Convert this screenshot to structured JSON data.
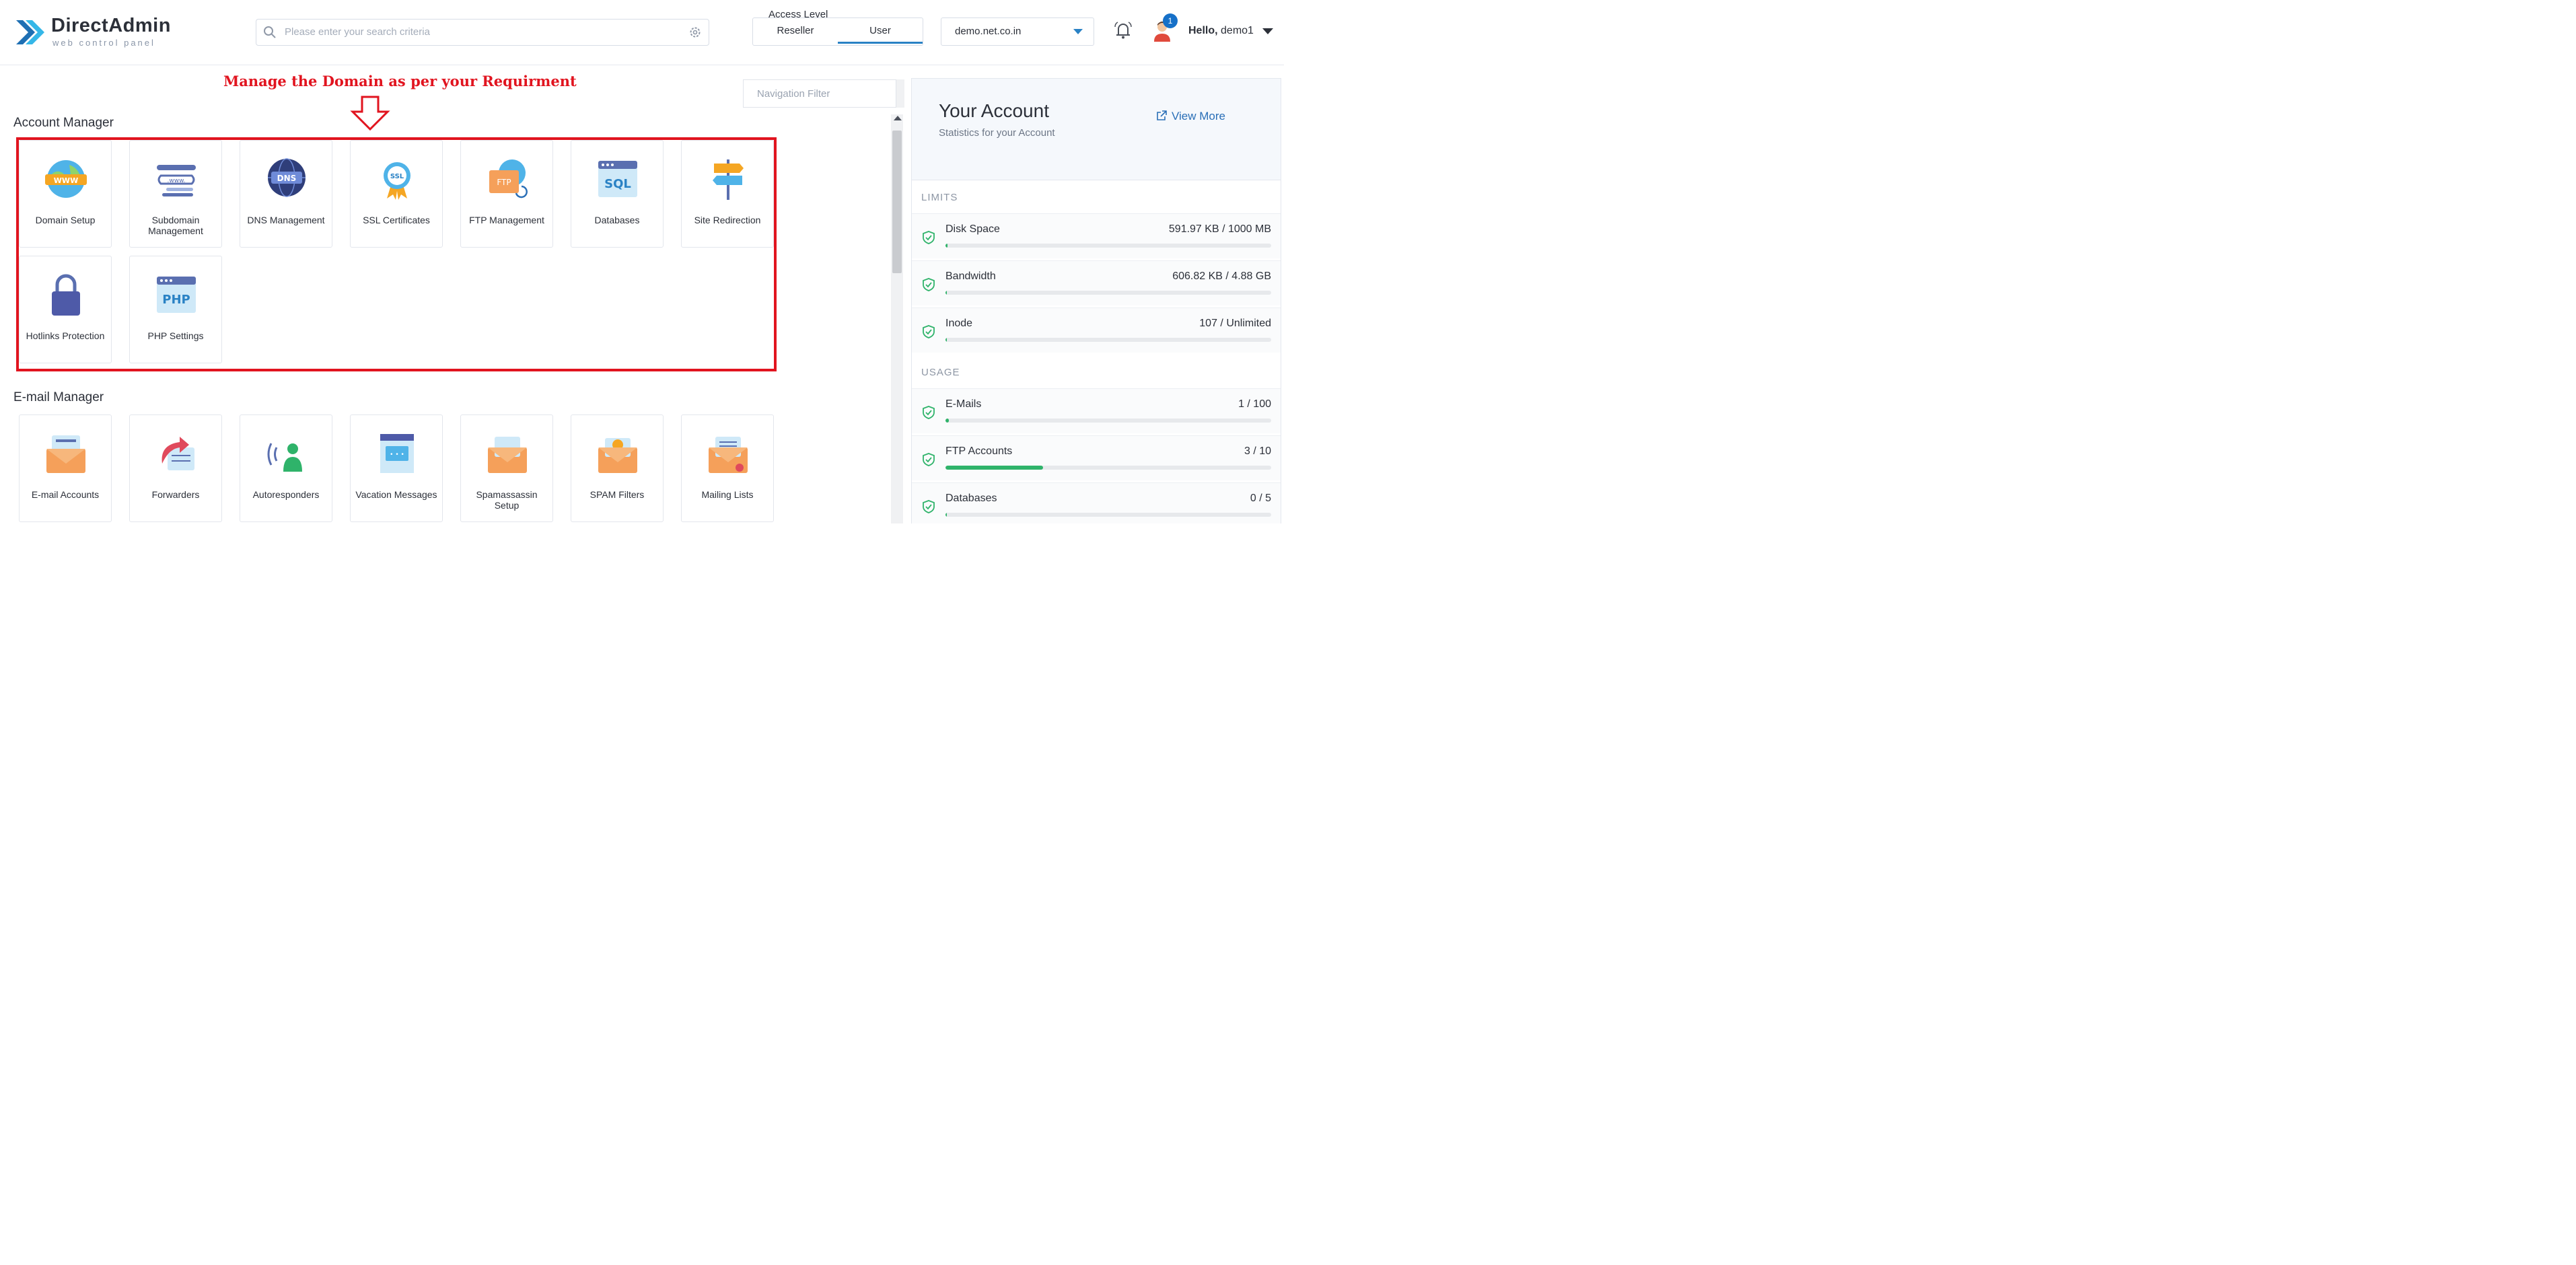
{
  "app": {
    "brand": "DirectAdmin",
    "brand_sub": "web control panel"
  },
  "search": {
    "placeholder": "Please enter your search criteria"
  },
  "access": {
    "title": "Access Level",
    "options": [
      "Reseller",
      "User"
    ],
    "selected": "User"
  },
  "domain_select": {
    "value": "demo.net.co.in"
  },
  "notifications": {
    "count": "1"
  },
  "user": {
    "greeting": "Hello,",
    "name": "demo1"
  },
  "annotation": {
    "text": "Manage the Domain as per your Requirment"
  },
  "nav_filter": {
    "placeholder": "Navigation Filter"
  },
  "account_manager": {
    "title": "Account Manager",
    "items": [
      {
        "label": "Domain Setup",
        "icon": "globe-www-icon"
      },
      {
        "label": "Subdomain Management",
        "icon": "subdomain-icon"
      },
      {
        "label": "DNS Management",
        "icon": "dns-globe-icon"
      },
      {
        "label": "SSL Certificates",
        "icon": "ssl-badge-icon"
      },
      {
        "label": "FTP Management",
        "icon": "ftp-folder-icon"
      },
      {
        "label": "Databases",
        "icon": "sql-database-icon"
      },
      {
        "label": "Site Redirection",
        "icon": "signpost-icon"
      },
      {
        "label": "Hotlinks Protection",
        "icon": "padlock-icon"
      },
      {
        "label": "PHP Settings",
        "icon": "php-window-icon"
      }
    ]
  },
  "email_manager": {
    "title": "E-mail Manager",
    "items": [
      {
        "label": "E-mail Accounts",
        "icon": "envelope-accounts-icon"
      },
      {
        "label": "Forwarders",
        "icon": "forward-envelope-icon"
      },
      {
        "label": "Autoresponders",
        "icon": "autoresponder-person-icon"
      },
      {
        "label": "Vacation Messages",
        "icon": "vacation-calendar-icon"
      },
      {
        "label": "Spamassassin Setup",
        "icon": "spam-envelope-icon"
      },
      {
        "label": "SPAM Filters",
        "icon": "spam-filter-icon"
      },
      {
        "label": "Mailing Lists",
        "icon": "mailing-list-icon"
      }
    ]
  },
  "account": {
    "title": "Your Account",
    "subtitle": "Statistics for your Account",
    "view_more": "View More",
    "limits_label": "LIMITS",
    "usage_label": "USAGE",
    "limits": [
      {
        "name": "Disk Space",
        "value": "591.97 KB / 1000 MB",
        "fraction": 0.006
      },
      {
        "name": "Bandwidth",
        "value": "606.82 KB / 4.88 GB",
        "fraction": 0.002
      },
      {
        "name": "Inode",
        "value": "107 / Unlimited",
        "fraction": 0.002
      }
    ],
    "usage": [
      {
        "name": "E-Mails",
        "value": "1 / 100",
        "fraction": 0.01
      },
      {
        "name": "FTP Accounts",
        "value": "3 / 10",
        "fraction": 0.3
      },
      {
        "name": "Databases",
        "value": "0 / 5",
        "fraction": 0.0
      }
    ],
    "accent_color": "#2fb36a"
  }
}
